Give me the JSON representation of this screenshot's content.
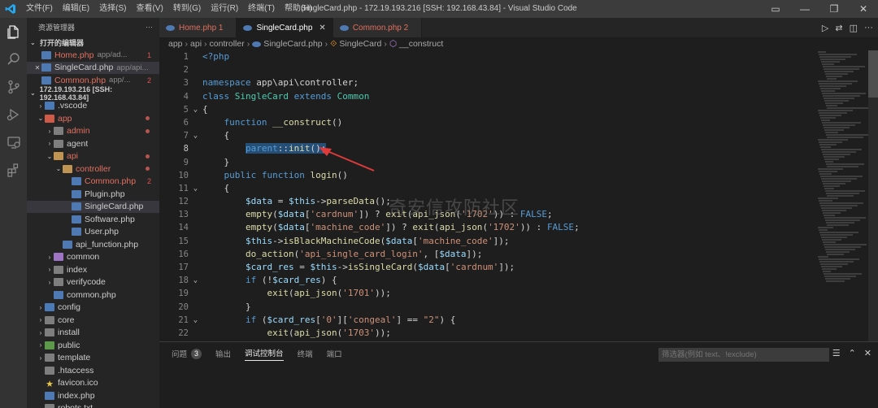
{
  "titlebar": {
    "menu": [
      "文件(F)",
      "编辑(E)",
      "选择(S)",
      "查看(V)",
      "转到(G)",
      "运行(R)",
      "终端(T)",
      "帮助(H)"
    ],
    "title": "SingleCard.php - 172.19.193.216 [SSH: 192.168.43.84] - Visual Studio Code"
  },
  "sidebar": {
    "header": "资源管理器",
    "header_more": "···",
    "open_editors_title": "打开的编辑器",
    "open_editors": [
      {
        "name": "Home.php",
        "path": "app/ad...",
        "badge": "1",
        "modified": true,
        "close": ""
      },
      {
        "name": "SingleCard.php",
        "path": "app/api...",
        "badge": "",
        "modified": false,
        "close": "✕"
      },
      {
        "name": "Common.php",
        "path": "app/...",
        "badge": "2",
        "modified": true,
        "close": ""
      }
    ],
    "workspace_title": "172.19.193.216 [SSH: 192.168.43.84]",
    "tree": [
      {
        "label": ".vscode",
        "indent": 0,
        "twist": "›",
        "icon": "folder-blue",
        "status": "plain",
        "mark": ""
      },
      {
        "label": "app",
        "indent": 0,
        "twist": "⌄",
        "icon": "folder-red",
        "status": "mod",
        "mark": "dot"
      },
      {
        "label": "admin",
        "indent": 1,
        "twist": "›",
        "icon": "folder-gray",
        "status": "mod",
        "mark": "dot"
      },
      {
        "label": "agent",
        "indent": 1,
        "twist": "›",
        "icon": "folder-gray",
        "status": "plain",
        "mark": ""
      },
      {
        "label": "api",
        "indent": 1,
        "twist": "⌄",
        "icon": "folder",
        "status": "mod",
        "mark": "dot"
      },
      {
        "label": "controller",
        "indent": 2,
        "twist": "⌄",
        "icon": "folder",
        "status": "mod",
        "mark": "dot"
      },
      {
        "label": "Common.php",
        "indent": 3,
        "twist": "",
        "icon": "php",
        "status": "mod",
        "mark": "2"
      },
      {
        "label": "Plugin.php",
        "indent": 3,
        "twist": "",
        "icon": "php",
        "status": "plain",
        "mark": ""
      },
      {
        "label": "SingleCard.php",
        "indent": 3,
        "twist": "",
        "icon": "php",
        "status": "plain",
        "mark": "",
        "selected": true
      },
      {
        "label": "Software.php",
        "indent": 3,
        "twist": "",
        "icon": "php",
        "status": "plain",
        "mark": ""
      },
      {
        "label": "User.php",
        "indent": 3,
        "twist": "",
        "icon": "php",
        "status": "plain",
        "mark": ""
      },
      {
        "label": "api_function.php",
        "indent": 2,
        "twist": "",
        "icon": "php",
        "status": "plain",
        "mark": ""
      },
      {
        "label": "common",
        "indent": 1,
        "twist": "›",
        "icon": "folder-purple",
        "status": "plain",
        "mark": ""
      },
      {
        "label": "index",
        "indent": 1,
        "twist": "›",
        "icon": "folder-gray",
        "status": "plain",
        "mark": ""
      },
      {
        "label": "verifycode",
        "indent": 1,
        "twist": "›",
        "icon": "folder-gray",
        "status": "plain",
        "mark": ""
      },
      {
        "label": "common.php",
        "indent": 1,
        "twist": "",
        "icon": "php",
        "status": "plain",
        "mark": ""
      },
      {
        "label": "config",
        "indent": 0,
        "twist": "›",
        "icon": "folder-blue",
        "status": "plain",
        "mark": ""
      },
      {
        "label": "core",
        "indent": 0,
        "twist": "›",
        "icon": "folder-gray",
        "status": "plain",
        "mark": ""
      },
      {
        "label": "install",
        "indent": 0,
        "twist": "›",
        "icon": "folder-gray",
        "status": "plain",
        "mark": ""
      },
      {
        "label": "public",
        "indent": 0,
        "twist": "›",
        "icon": "folder-green",
        "status": "plain",
        "mark": ""
      },
      {
        "label": "template",
        "indent": 0,
        "twist": "›",
        "icon": "folder-gray",
        "status": "plain",
        "mark": ""
      },
      {
        "label": ".htaccess",
        "indent": 0,
        "twist": "",
        "icon": "folder-gray",
        "status": "plain",
        "mark": ""
      },
      {
        "label": "favicon.ico",
        "indent": 0,
        "twist": "",
        "icon": "star",
        "status": "plain",
        "mark": ""
      },
      {
        "label": "index.php",
        "indent": 0,
        "twist": "",
        "icon": "php",
        "status": "plain",
        "mark": ""
      },
      {
        "label": "robots.txt",
        "indent": 0,
        "twist": "",
        "icon": "folder-gray",
        "status": "plain",
        "mark": ""
      }
    ]
  },
  "tabs": [
    {
      "label": "Home.php 1",
      "active": false,
      "close": ""
    },
    {
      "label": "SingleCard.php",
      "active": true,
      "close": "✕"
    },
    {
      "label": "Common.php 2",
      "active": false,
      "close": ""
    }
  ],
  "breadcrumb": [
    "app",
    "api",
    "controller",
    "SingleCard.php",
    "SingleCard",
    "__construct"
  ],
  "code": [
    {
      "n": "1",
      "t": [
        [
          "tag",
          "<?php"
        ]
      ]
    },
    {
      "n": "2",
      "t": []
    },
    {
      "n": "3",
      "t": [
        [
          "kw",
          "namespace "
        ],
        [
          "pl",
          "app\\api\\controller;"
        ]
      ]
    },
    {
      "n": "4",
      "t": [
        [
          "kw",
          "class "
        ],
        [
          "cls",
          "SingleCard "
        ],
        [
          "kw",
          "extends "
        ],
        [
          "cls",
          "Common"
        ]
      ]
    },
    {
      "n": "5",
      "fold": "⌄",
      "t": [
        [
          "pl",
          "{"
        ]
      ]
    },
    {
      "n": "6",
      "t": [
        [
          "pl",
          "    "
        ],
        [
          "kw",
          "function "
        ],
        [
          "fn",
          "__construct"
        ],
        [
          "pl",
          "()"
        ]
      ]
    },
    {
      "n": "7",
      "fold": "⌄",
      "t": [
        [
          "pl",
          "    {"
        ]
      ]
    },
    {
      "n": "8",
      "cur": true,
      "t": [
        [
          "pl",
          "        "
        ],
        [
          "kw",
          "parent"
        ],
        [
          "pl",
          "::"
        ],
        [
          "fn",
          "init"
        ],
        [
          "pl",
          "();"
        ]
      ]
    },
    {
      "n": "9",
      "t": [
        [
          "pl",
          "    }"
        ]
      ]
    },
    {
      "n": "10",
      "t": [
        [
          "pl",
          "    "
        ],
        [
          "kw",
          "public function "
        ],
        [
          "fn",
          "login"
        ],
        [
          "pl",
          "()"
        ]
      ]
    },
    {
      "n": "11",
      "fold": "⌄",
      "t": [
        [
          "pl",
          "    {"
        ]
      ]
    },
    {
      "n": "12",
      "t": [
        [
          "pl",
          "        "
        ],
        [
          "vr",
          "$data"
        ],
        [
          "pl",
          " = "
        ],
        [
          "vr",
          "$this"
        ],
        [
          "pl",
          "->"
        ],
        [
          "fn",
          "parseData"
        ],
        [
          "pl",
          "();"
        ]
      ]
    },
    {
      "n": "13",
      "t": [
        [
          "pl",
          "        "
        ],
        [
          "fn",
          "empty"
        ],
        [
          "pl",
          "("
        ],
        [
          "vr",
          "$data"
        ],
        [
          "pl",
          "["
        ],
        [
          "st",
          "'cardnum'"
        ],
        [
          "pl",
          "]) ? "
        ],
        [
          "fn",
          "exit"
        ],
        [
          "pl",
          "("
        ],
        [
          "fn",
          "api_json"
        ],
        [
          "pl",
          "("
        ],
        [
          "st",
          "'1702'"
        ],
        [
          "pl",
          ")) : "
        ],
        [
          "kw",
          "FALSE"
        ],
        [
          "pl",
          ";"
        ]
      ]
    },
    {
      "n": "14",
      "t": [
        [
          "pl",
          "        "
        ],
        [
          "fn",
          "empty"
        ],
        [
          "pl",
          "("
        ],
        [
          "vr",
          "$data"
        ],
        [
          "pl",
          "["
        ],
        [
          "st",
          "'machine_code'"
        ],
        [
          "pl",
          "]) ? "
        ],
        [
          "fn",
          "exit"
        ],
        [
          "pl",
          "("
        ],
        [
          "fn",
          "api_json"
        ],
        [
          "pl",
          "("
        ],
        [
          "st",
          "'1702'"
        ],
        [
          "pl",
          ")) : "
        ],
        [
          "kw",
          "FALSE"
        ],
        [
          "pl",
          ";"
        ]
      ]
    },
    {
      "n": "15",
      "t": [
        [
          "pl",
          "        "
        ],
        [
          "vr",
          "$this"
        ],
        [
          "pl",
          "->"
        ],
        [
          "fn",
          "isBlackMachineCode"
        ],
        [
          "pl",
          "("
        ],
        [
          "vr",
          "$data"
        ],
        [
          "pl",
          "["
        ],
        [
          "st",
          "'machine_code'"
        ],
        [
          "pl",
          "]);"
        ]
      ]
    },
    {
      "n": "16",
      "t": [
        [
          "pl",
          "        "
        ],
        [
          "fn",
          "do_action"
        ],
        [
          "pl",
          "("
        ],
        [
          "st",
          "'api_single_card_login'"
        ],
        [
          "pl",
          ", ["
        ],
        [
          "vr",
          "$data"
        ],
        [
          "pl",
          "]);"
        ]
      ]
    },
    {
      "n": "17",
      "t": [
        [
          "pl",
          "        "
        ],
        [
          "vr",
          "$card_res"
        ],
        [
          "pl",
          " = "
        ],
        [
          "vr",
          "$this"
        ],
        [
          "pl",
          "->"
        ],
        [
          "fn",
          "isSingleCard"
        ],
        [
          "pl",
          "("
        ],
        [
          "vr",
          "$data"
        ],
        [
          "pl",
          "["
        ],
        [
          "st",
          "'cardnum'"
        ],
        [
          "pl",
          "]);"
        ]
      ]
    },
    {
      "n": "18",
      "fold": "⌄",
      "t": [
        [
          "pl",
          "        "
        ],
        [
          "kw",
          "if "
        ],
        [
          "pl",
          "(!"
        ],
        [
          "vr",
          "$card_res"
        ],
        [
          "pl",
          ") {"
        ]
      ]
    },
    {
      "n": "19",
      "t": [
        [
          "pl",
          "            "
        ],
        [
          "fn",
          "exit"
        ],
        [
          "pl",
          "("
        ],
        [
          "fn",
          "api_json"
        ],
        [
          "pl",
          "("
        ],
        [
          "st",
          "'1701'"
        ],
        [
          "pl",
          "));"
        ]
      ]
    },
    {
      "n": "20",
      "t": [
        [
          "pl",
          "        }"
        ]
      ]
    },
    {
      "n": "21",
      "fold": "⌄",
      "t": [
        [
          "pl",
          "        "
        ],
        [
          "kw",
          "if "
        ],
        [
          "pl",
          "("
        ],
        [
          "vr",
          "$card_res"
        ],
        [
          "pl",
          "["
        ],
        [
          "st",
          "'0'"
        ],
        [
          "pl",
          "]["
        ],
        [
          "st",
          "'congeal'"
        ],
        [
          "pl",
          "] == "
        ],
        [
          "st",
          "\"2\""
        ],
        [
          "pl",
          ") {"
        ]
      ]
    },
    {
      "n": "22",
      "t": [
        [
          "pl",
          "            "
        ],
        [
          "fn",
          "exit"
        ],
        [
          "pl",
          "("
        ],
        [
          "fn",
          "api_json"
        ],
        [
          "pl",
          "("
        ],
        [
          "st",
          "'1703'"
        ],
        [
          "pl",
          "));"
        ]
      ]
    },
    {
      "n": "23",
      "t": [
        [
          "pl",
          "        }"
        ]
      ]
    }
  ],
  "panel": {
    "tabs": [
      {
        "label": "问题",
        "count": "3",
        "active": false
      },
      {
        "label": "输出",
        "count": "",
        "active": false
      },
      {
        "label": "调试控制台",
        "count": "",
        "active": true
      },
      {
        "label": "终端",
        "count": "",
        "active": false
      },
      {
        "label": "端口",
        "count": "",
        "active": false
      }
    ],
    "filter_placeholder": "筛选器(例如 text、!exclude)"
  },
  "watermark": "奇安信攻防社区",
  "colors": {
    "accent": "#007acc",
    "modified": "#e2705e",
    "arrow": "#e03a3a"
  }
}
